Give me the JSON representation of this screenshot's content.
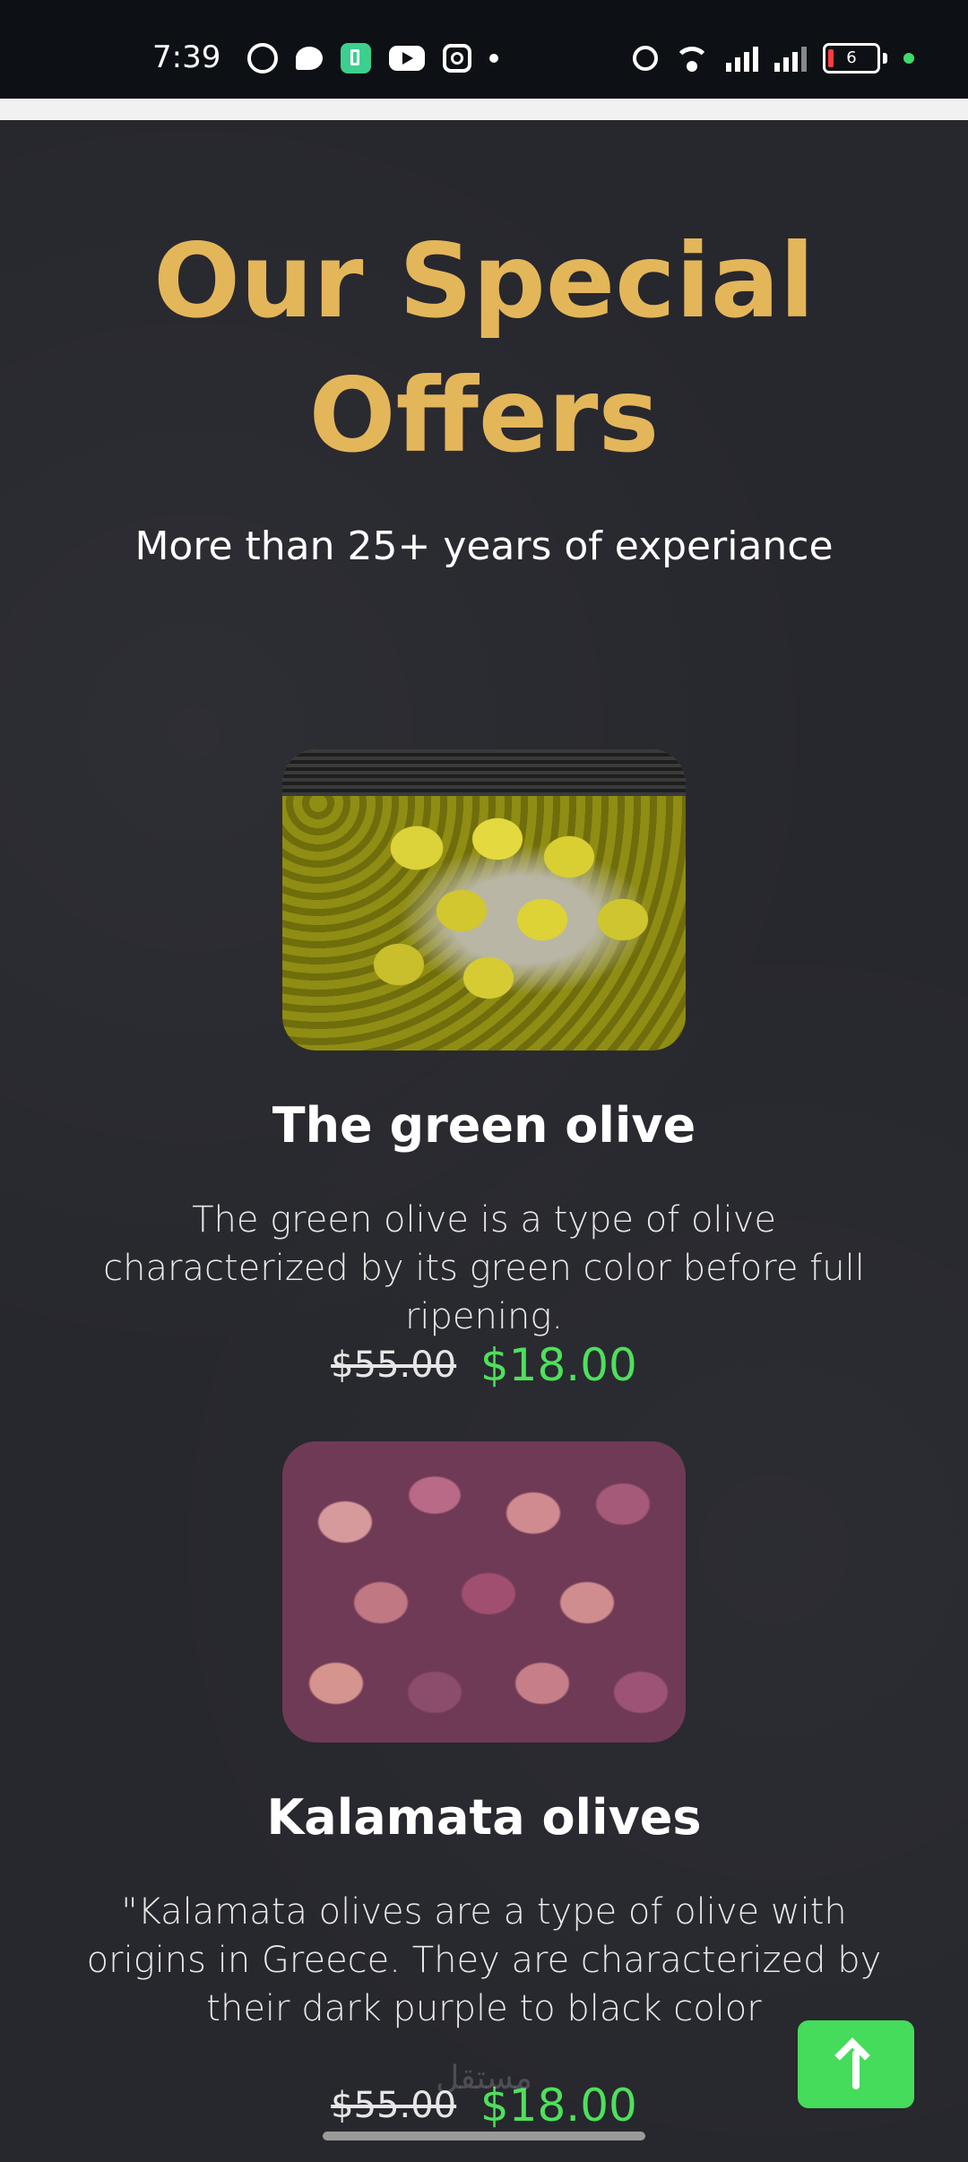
{
  "status_bar": {
    "time": "7:39",
    "battery_level": "6",
    "icons": [
      "whatsapp-icon",
      "chat-icon",
      "battery-app-icon",
      "youtube-icon",
      "instagram-icon",
      "dot-icon",
      "alarm-icon",
      "wifi-icon",
      "signal-icon",
      "signal-icon",
      "battery-icon"
    ]
  },
  "section": {
    "title_line1": "Our Special",
    "title_line2": "Offers",
    "subtitle": "More than 25+ years of experiance"
  },
  "products": [
    {
      "name": "The green olive",
      "description": "The green olive is a type of olive characterized by its green color before full ripening.",
      "old_price": "$55.00",
      "new_price": "$18.00"
    },
    {
      "name": "Kalamata olives",
      "description": "\"Kalamata olives are a type of olive with origins in Greece. They are characterized by their dark purple to black color",
      "old_price": "$55.00",
      "new_price": "$18.00"
    }
  ],
  "scroll_top_button": {
    "icon": "arrow-up-icon"
  },
  "watermark": {
    "text": "مستقل"
  },
  "colors": {
    "accent_title": "#e4b65a",
    "price_new": "#4ee05c",
    "scroll_button": "#44dc5a",
    "background": "#27272e"
  }
}
